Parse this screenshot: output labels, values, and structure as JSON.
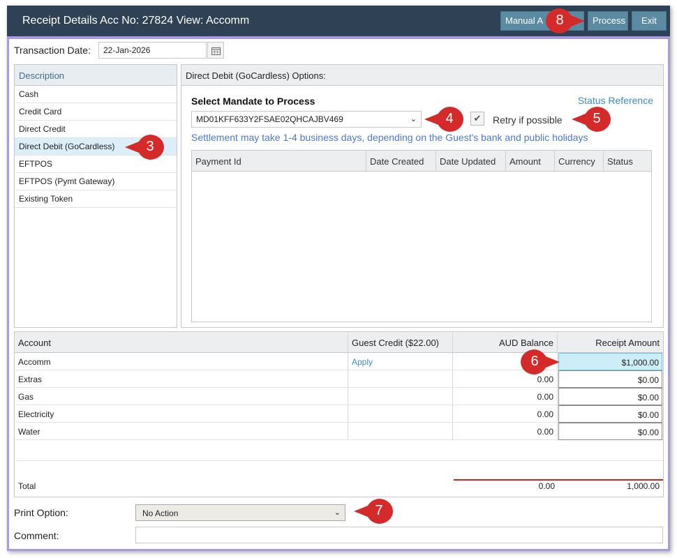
{
  "window": {
    "title": "Receipt Details Acc No: 27824 View: Accomm",
    "buttons": {
      "manual": "Manual A",
      "process": "Process",
      "exit": "Exit"
    }
  },
  "transaction": {
    "label": "Transaction Date:",
    "value": "22-Jan-2026"
  },
  "methods": {
    "header": "Description",
    "items": [
      "Cash",
      "Credit Card",
      "Direct Credit",
      "Direct Debit (GoCardless)",
      "EFTPOS",
      "EFTPOS (Pymt Gateway)",
      "Existing Token"
    ],
    "selected_index": 3
  },
  "direct_debit": {
    "header": "Direct Debit (GoCardless) Options:",
    "mandate_label": "Select Mandate to Process",
    "status_reference": "Status Reference",
    "mandate_value": "MD01KFF633Y2FSAE02QHCAJBV469",
    "retry_label": "Retry if possible",
    "retry_checked": true,
    "settlement_note": "Settlement may take 1-4 business days, depending on the Guest's bank and public holidays",
    "payment_columns": [
      "Payment Id",
      "Date Created",
      "Date Updated",
      "Amount",
      "Currency",
      "Status"
    ]
  },
  "accounts": {
    "headers": [
      "Account",
      "Guest Credit ($22.00)",
      "AUD Balance",
      "Receipt Amount"
    ],
    "rows": [
      {
        "account": "Accomm",
        "credit": "Apply",
        "balance": "",
        "receipt": "$1,000.00"
      },
      {
        "account": "Extras",
        "credit": "",
        "balance": "0.00",
        "receipt": "$0.00"
      },
      {
        "account": "Gas",
        "credit": "",
        "balance": "0.00",
        "receipt": "$0.00"
      },
      {
        "account": "Electricity",
        "credit": "",
        "balance": "0.00",
        "receipt": "$0.00"
      },
      {
        "account": "Water",
        "credit": "",
        "balance": "0.00",
        "receipt": "$0.00"
      }
    ],
    "total_label": "Total",
    "total_balance": "0.00",
    "total_receipt": "1,000.00"
  },
  "print_option": {
    "label": "Print Option:",
    "value": "No Action"
  },
  "comment": {
    "label": "Comment:",
    "value": ""
  },
  "callouts": [
    "8",
    "3",
    "4",
    "5",
    "6",
    "7"
  ],
  "colors": {
    "titlebar": "#2f4154",
    "button": "#5b8aa3",
    "frame": "#a99be2",
    "link": "#3a8cc9",
    "callout": "#d42a2a"
  }
}
